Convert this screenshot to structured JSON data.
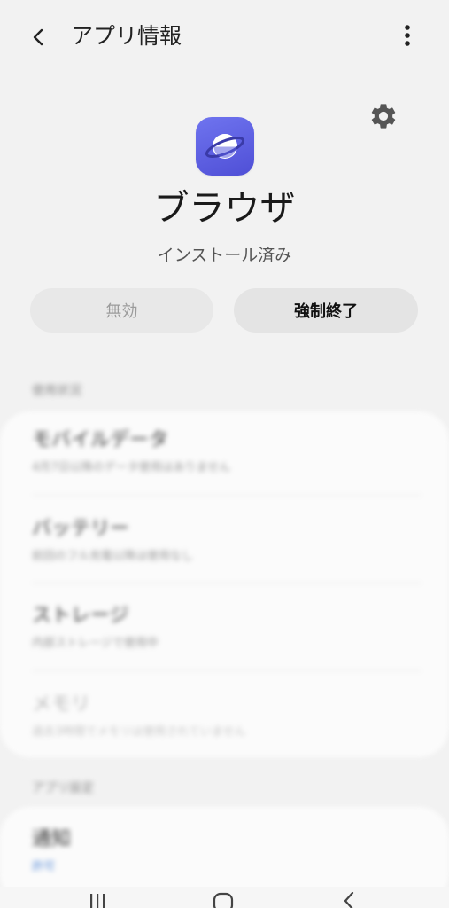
{
  "header": {
    "title": "アプリ情報",
    "back_icon": "chevron-left-icon",
    "more_icon": "more-vertical-icon",
    "settings_icon": "gear-icon"
  },
  "app": {
    "name": "ブラウザ",
    "status": "インストール済み",
    "icon": "planet-icon",
    "icon_color": "#5c5fe3"
  },
  "actions": {
    "disable_label": "無効",
    "force_stop_label": "強制終了"
  },
  "usage_section": {
    "label": "使用状況",
    "items": [
      {
        "title": "モバイルデータ",
        "subtitle": "4月7日以降のデータ使用はありません",
        "enabled": true
      },
      {
        "title": "バッテリー",
        "subtitle": "前回のフル充電以降は使用なし",
        "enabled": true
      },
      {
        "title": "ストレージ",
        "subtitle": "内部ストレージで使用中",
        "enabled": true
      },
      {
        "title": "メモリ",
        "subtitle": "過去3時間でメモリは使用されていません",
        "enabled": false
      }
    ]
  },
  "app_settings_section": {
    "label": "アプリ設定",
    "items": [
      {
        "title": "通知",
        "subtitle": "許可"
      }
    ]
  },
  "navbar": {
    "recents_icon": "recents-icon",
    "home_icon": "home-icon",
    "back_icon": "nav-back-icon"
  }
}
